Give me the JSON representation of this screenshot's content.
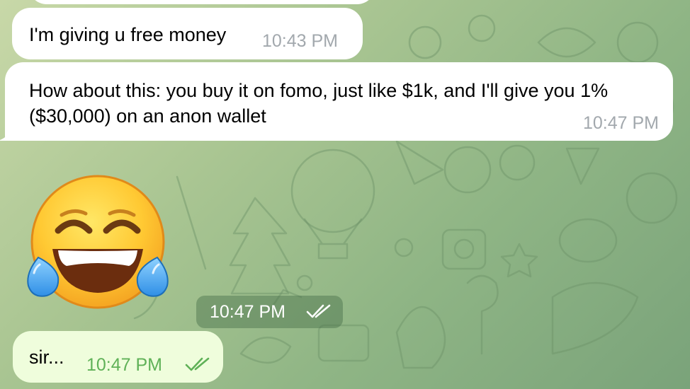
{
  "messages": [
    {
      "text": "I'm giving u free money",
      "time": "10:43 PM",
      "direction": "incoming"
    },
    {
      "text": "How about this: you buy it on fomo, just like $1k, and I'll give you 1% ($30,000) on an anon wallet",
      "time": "10:47 PM",
      "direction": "incoming"
    },
    {
      "sticker": "face-with-tears-of-joy",
      "time": "10:47 PM",
      "direction": "outgoing",
      "status": "read"
    },
    {
      "text": "sir...",
      "time": "10:47 PM",
      "direction": "outgoing",
      "status": "read"
    }
  ],
  "colors": {
    "incoming_bubble": "#ffffff",
    "outgoing_bubble": "#effddc",
    "incoming_time": "#a2a8ad",
    "outgoing_time": "#5fb157",
    "background": "#9dbf8c"
  }
}
